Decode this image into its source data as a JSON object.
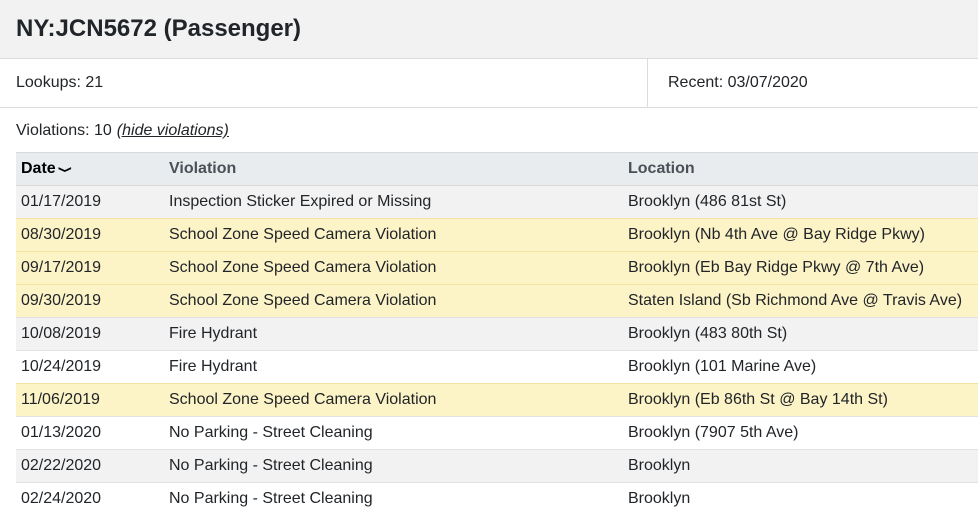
{
  "header": {
    "title": "NY:JCN5672 (Passenger)"
  },
  "stats": {
    "lookups": "Lookups: 21",
    "recent": "Recent: 03/07/2020"
  },
  "violations": {
    "count_label": "Violations: 10",
    "toggle_label": "(hide violations)"
  },
  "table": {
    "columns": {
      "date": "Date",
      "violation": "Violation",
      "location": "Location"
    },
    "rows": [
      {
        "date": "01/17/2019",
        "violation": "Inspection Sticker Expired or Missing",
        "location": "Brooklyn (486 81st St)",
        "highlight": false
      },
      {
        "date": "08/30/2019",
        "violation": "School Zone Speed Camera Violation",
        "location": "Brooklyn (Nb 4th Ave @ Bay Ridge Pkwy)",
        "highlight": true
      },
      {
        "date": "09/17/2019",
        "violation": "School Zone Speed Camera Violation",
        "location": "Brooklyn (Eb Bay Ridge Pkwy @ 7th Ave)",
        "highlight": true
      },
      {
        "date": "09/30/2019",
        "violation": "School Zone Speed Camera Violation",
        "location": "Staten Island (Sb Richmond Ave @ Travis Ave)",
        "highlight": true
      },
      {
        "date": "10/08/2019",
        "violation": "Fire Hydrant",
        "location": "Brooklyn (483 80th St)",
        "highlight": false
      },
      {
        "date": "10/24/2019",
        "violation": "Fire Hydrant",
        "location": "Brooklyn (101 Marine Ave)",
        "highlight": false
      },
      {
        "date": "11/06/2019",
        "violation": "School Zone Speed Camera Violation",
        "location": "Brooklyn (Eb 86th St @ Bay 14th St)",
        "highlight": true
      },
      {
        "date": "01/13/2020",
        "violation": "No Parking - Street Cleaning",
        "location": "Brooklyn (7907 5th Ave)",
        "highlight": false
      },
      {
        "date": "02/22/2020",
        "violation": "No Parking - Street Cleaning",
        "location": "Brooklyn",
        "highlight": false
      },
      {
        "date": "02/24/2020",
        "violation": "No Parking - Street Cleaning",
        "location": "Brooklyn",
        "highlight": false
      }
    ]
  },
  "colors": {
    "highlight_row": "#fcf3c6",
    "striped_row": "#f2f2f2",
    "header_bg": "#f2f2f2"
  },
  "icons": {
    "sort": "chevron-down-icon"
  }
}
